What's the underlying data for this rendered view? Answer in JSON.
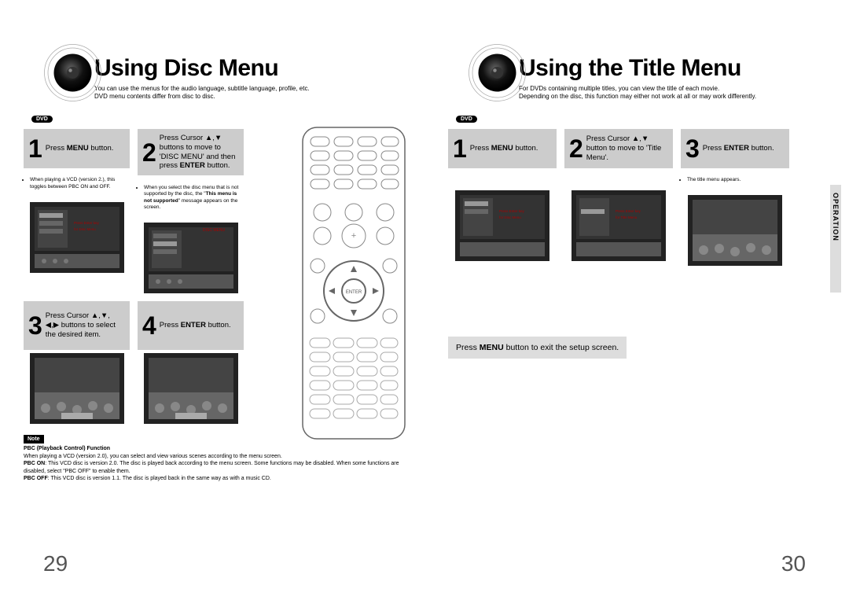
{
  "left": {
    "title": "Using Disc Menu",
    "subtitle1": "You can use the menus for the audio language, subtitle language, profile, etc.",
    "subtitle2": "DVD menu contents differ from disc to disc.",
    "badge": "DVD",
    "step1_num": "1",
    "step1_text": "Press <b>MENU</b> button.",
    "step1_note": "When playing a VCD (version 2.), this toggles between PBC ON and OFF.",
    "step2_num": "2",
    "step2_text": "Press Cursor ▲,▼ buttons to move to 'DISC MENU' and then press <b>ENTER</b> button.",
    "step2_note": "When you select the disc menu that is not supported by the disc, the \"<b>This menu is not supported</b>\" message appears on the screen.",
    "step3_num": "3",
    "step3_text": "Press Cursor ▲,▼, ◀,▶ buttons to select the desired item.",
    "step4_num": "4",
    "step4_text": "Press <b>ENTER</b> button.",
    "note_label": "Note",
    "note_title": "PBC (Playback Control) Function",
    "note_body1": "When playing a VCD (version 2.0), you can select and view various scenes according to the menu screen.",
    "note_body2": "<b>PBC ON</b>: This VCD disc is version 2.0. The disc is played back according to the menu screen. Some functions may be disabled. When some functions are disabled, select \"PBC OFF\" to enable them.",
    "note_body3": "<b>PBC OFF</b>: This VCD disc is version 1.1. The disc is played back in the same way as with a music CD.",
    "pagenum": "29"
  },
  "right": {
    "title": "Using the Title Menu",
    "subtitle1": "For DVDs containing multiple titles, you can view the title of each movie.",
    "subtitle2": "Depending on the disc, this function may either not work at all or may work differently.",
    "badge": "DVD",
    "step1_num": "1",
    "step1_text": "Press <b>MENU</b> button.",
    "step2_num": "2",
    "step2_text": "Press Cursor ▲,▼ button to move to 'Title Menu'.",
    "step3_num": "3",
    "step3_text": "Press <b>ENTER</b> button.",
    "step3_note": "The title menu appears.",
    "exit_hint": "Press <b>MENU</b> button to exit the setup screen.",
    "operation": "OPERATION",
    "pagenum": "30"
  }
}
